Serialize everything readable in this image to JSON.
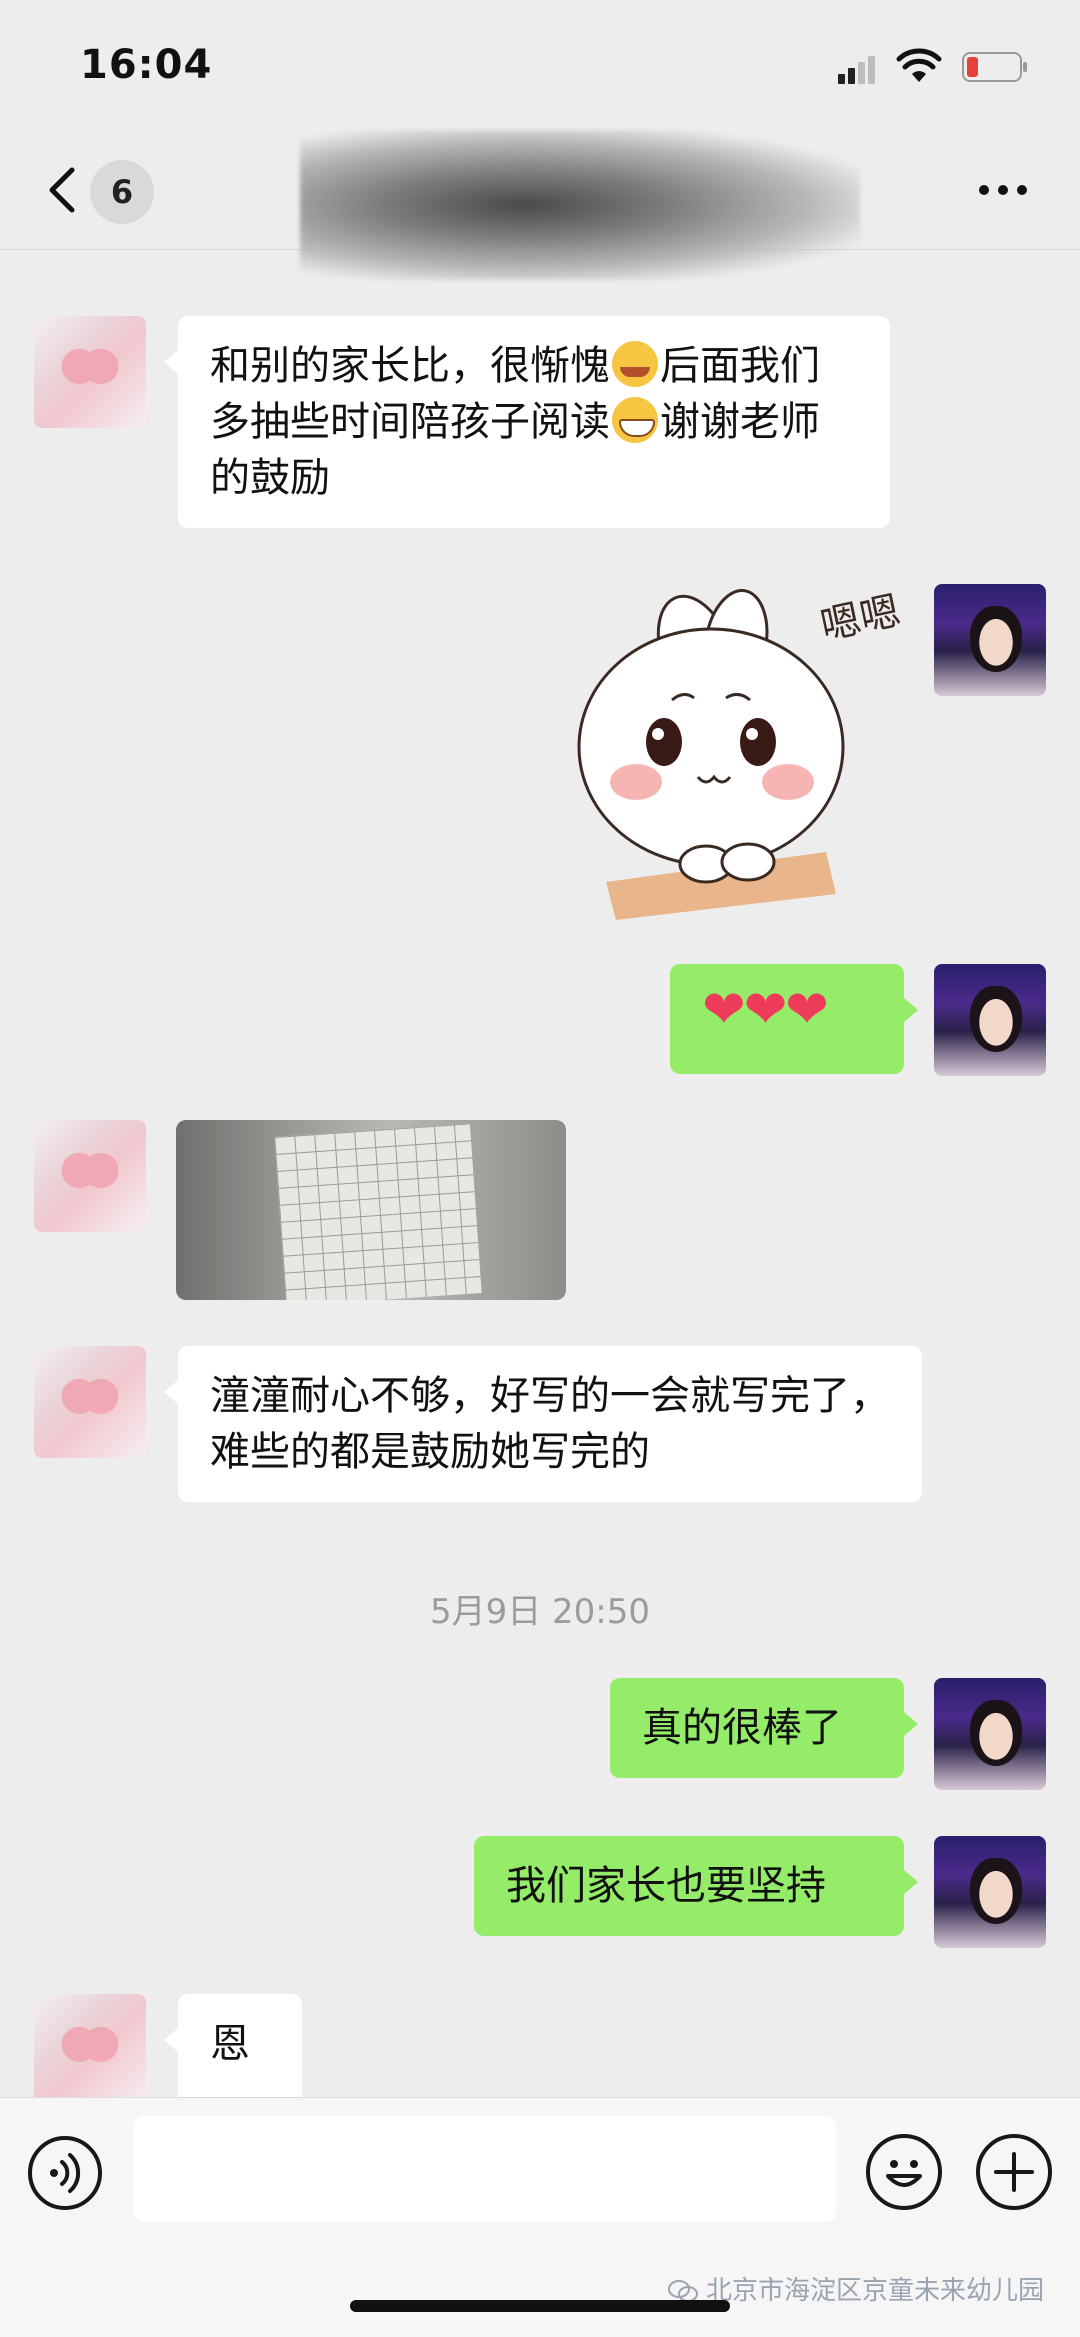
{
  "status_bar": {
    "time": "16:04"
  },
  "nav": {
    "unread_count": "6"
  },
  "messages": [
    {
      "side": "left",
      "text_1": "和别的家长比，很惭愧",
      "text_2": "后面我们多抽些时间陪孩子阅读",
      "text_3": "谢谢老师的鼓励"
    },
    {
      "side": "right",
      "sticker_text": "嗯嗯"
    },
    {
      "side": "right",
      "text": "❤❤❤"
    },
    {
      "side": "left",
      "type": "image"
    },
    {
      "side": "left",
      "text": "潼潼耐心不够，好写的一会就写完了，难些的都是鼓励她写完的"
    },
    {
      "side": "right",
      "text": "真的很棒了"
    },
    {
      "side": "right",
      "text": "我们家长也要坚持"
    },
    {
      "side": "left",
      "text": "恩"
    }
  ],
  "timestamp": "5月9日 20:50",
  "watermark": "北京市海淀区京童未来幼儿园",
  "colors": {
    "background": "#ededed",
    "bubble_self": "#95ec69",
    "bubble_other": "#ffffff"
  }
}
